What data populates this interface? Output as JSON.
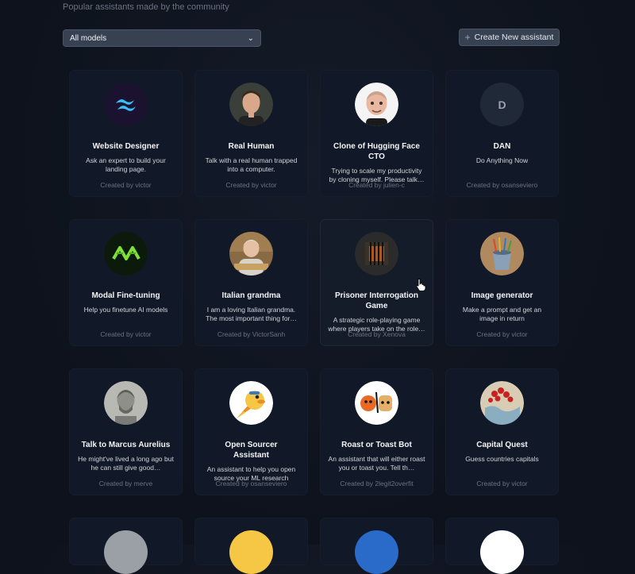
{
  "header": {
    "subtitle": "Popular assistants made by the community",
    "model_filter": "All models",
    "create_button": "Create New assistant"
  },
  "assistants": [
    {
      "name": "Website Designer",
      "desc": "Ask an expert to build your landing page.",
      "by": "Created by victor",
      "avatar": "tailwind-logo-icon"
    },
    {
      "name": "Real Human",
      "desc": "Talk with a real human trapped into a computer.",
      "by": "Created by victor",
      "avatar": "man-portrait-icon"
    },
    {
      "name": "Clone of Hugging Face CTO",
      "desc": "Trying to scale my productivity by cloning myself. Please talk…",
      "by": "Created by julien-c",
      "avatar": "memoji-icon"
    },
    {
      "name": "DAN",
      "desc": "Do Anything Now",
      "by": "Created by osanseviero",
      "avatar": "letter-d-icon",
      "letter": "D"
    },
    {
      "name": "Modal Fine-tuning",
      "desc": "Help you finetune AI models",
      "by": "Created by victor",
      "avatar": "modal-logo-icon"
    },
    {
      "name": "Italian grandma",
      "desc": "I am a loving Italian grandma. The most important thing for…",
      "by": "Created by VictorSanh",
      "avatar": "grandma-icon"
    },
    {
      "name": "Prisoner Interrogation Game",
      "desc": "A strategic role-playing game where players take on the role…",
      "by": "Created by Xenova",
      "avatar": "prison-icon"
    },
    {
      "name": "Image generator",
      "desc": "Make a prompt and get an image in return",
      "by": "Created by victor",
      "avatar": "paint-bucket-icon"
    },
    {
      "name": "Talk to Marcus Aurelius",
      "desc": "He might've lived a long ago but he can still give good…",
      "by": "Created by merve",
      "avatar": "bust-icon"
    },
    {
      "name": "Open Sourcer Assistant",
      "desc": "An assistant to help you open source your ML research",
      "by": "Created by osanseviero",
      "avatar": "rocket-duck-icon"
    },
    {
      "name": "Roast or Toast Bot",
      "desc": "An assistant that will either roast you or toast you. Tell th…",
      "by": "Created by 2legit2overfit",
      "avatar": "roast-toast-icon"
    },
    {
      "name": "Capital Quest",
      "desc": "Guess countries capitals",
      "by": "Created by victor",
      "avatar": "map-icon"
    }
  ],
  "colors": {
    "accent": "#38bdf8",
    "card_bg": "#111827",
    "page_bg": "#0f1420"
  }
}
